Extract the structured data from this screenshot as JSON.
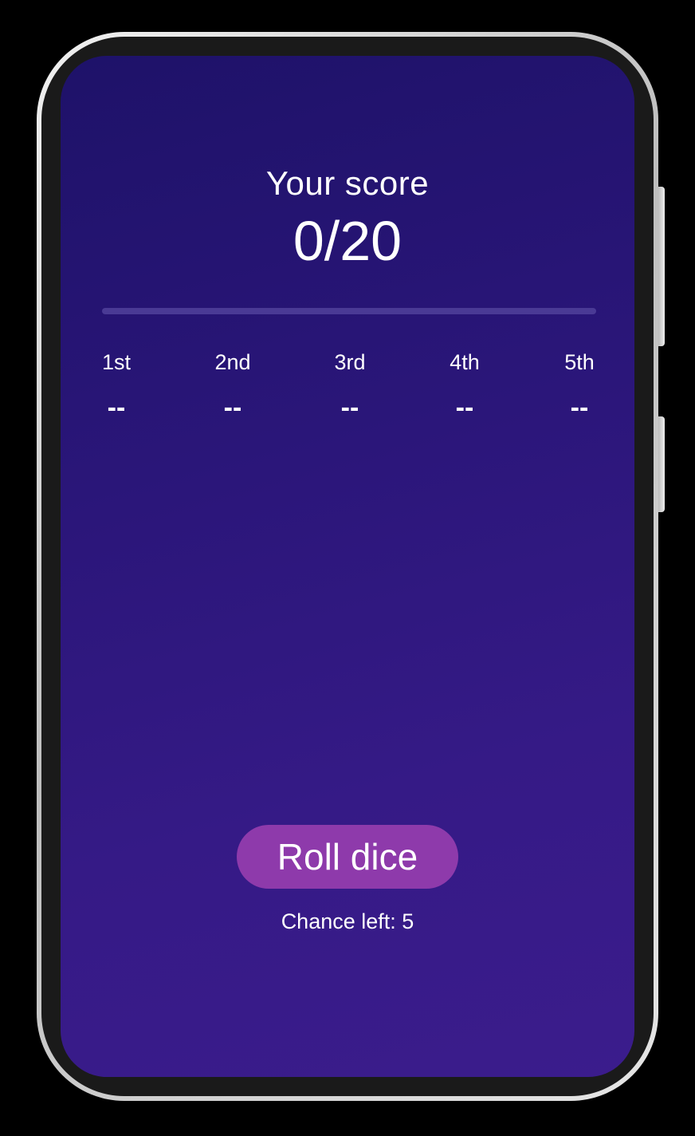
{
  "score": {
    "title": "Your score",
    "value": "0/20",
    "progress_fraction": 0
  },
  "rolls": [
    {
      "label": "1st",
      "value": "--"
    },
    {
      "label": "2nd",
      "value": "--"
    },
    {
      "label": "3rd",
      "value": "--"
    },
    {
      "label": "4th",
      "value": "--"
    },
    {
      "label": "5th",
      "value": "--"
    }
  ],
  "actions": {
    "roll_label": "Roll dice"
  },
  "status": {
    "chance_text": "Chance left: 5"
  },
  "colors": {
    "background_top": "#1e1269",
    "background_bottom": "#3b1c8c",
    "accent": "#8e3aab",
    "track": "#4a3a95",
    "text": "#ffffff"
  }
}
